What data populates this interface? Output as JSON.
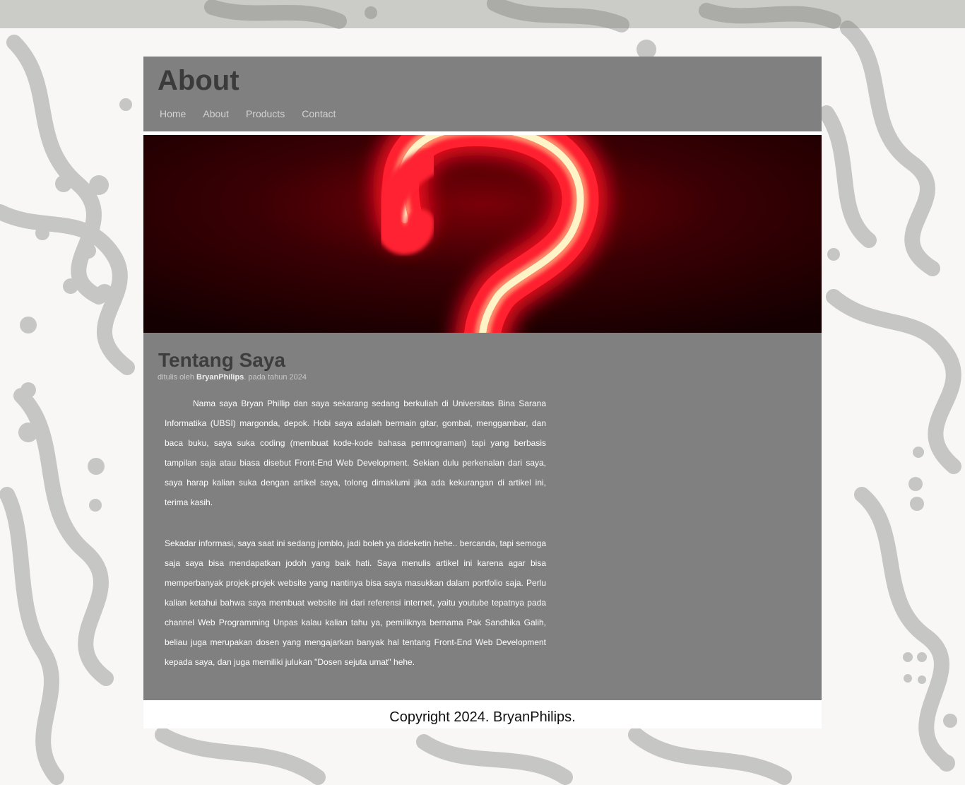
{
  "header": {
    "title": "About",
    "nav": [
      "Home",
      "About",
      "Products",
      "Contact"
    ]
  },
  "article": {
    "title": "Tentang Saya",
    "meta_prefix": "ditulis oleh ",
    "author": "BryanPhilips",
    "meta_suffix": ". pada tahun 2024",
    "paragraphs": [
      "Nama saya Bryan Phillip dan saya sekarang sedang berkuliah di Universitas Bina Sarana Informatika (UBSI) margonda, depok. Hobi saya adalah bermain gitar, gombal, menggambar, dan baca buku, saya suka coding (membuat kode-kode bahasa pemrograman) tapi yang berbasis tampilan saja atau biasa disebut Front-End Web Development. Sekian dulu perkenalan dari saya, saya harap kalian suka dengan artikel saya, tolong dimaklumi jika ada kekurangan di artikel ini, terima kasih.",
      "Sekadar informasi, saya saat ini sedang jomblo, jadi boleh ya dideketin hehe.. bercanda, tapi semoga saja saya bisa mendapatkan jodoh yang baik hati. Saya menulis artikel ini karena agar bisa memperbanyak projek-projek website yang nantinya bisa saya masukkan dalam portfolio saja. Perlu kalian ketahui bahwa saya membuat website ini dari referensi internet, yaitu youtube tepatnya pada channel Web Programming Unpas kalau kalian tahu ya, pemiliknya bernama Pak Sandhika Galih, beliau juga merupakan dosen yang mengajarkan banyak hal tentang Front-End Web Development kepada saya, dan juga memiliki julukan \"Dosen sejuta umat\" hehe."
    ]
  },
  "footer": {
    "copyright": "Copyright 2024. BryanPhilips."
  },
  "colors": {
    "panel": "#808080",
    "title_text": "#3b3b3b",
    "nav_text": "#d2d2d2",
    "neon": "#ff1a2a"
  }
}
